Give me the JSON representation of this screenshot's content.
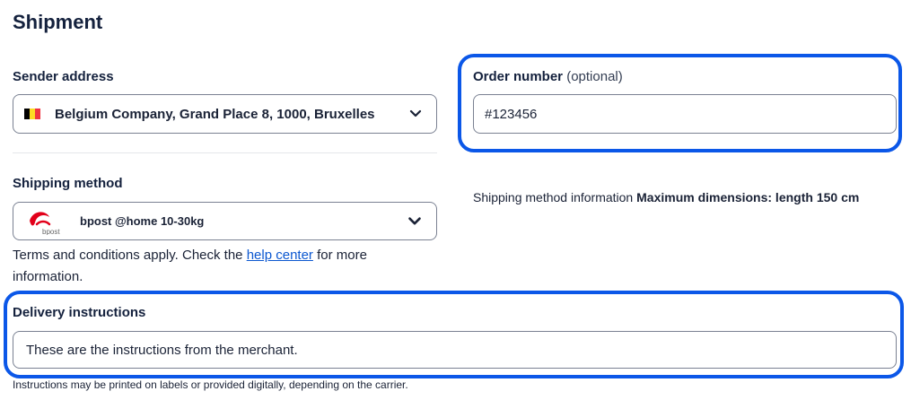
{
  "page": {
    "title": "Shipment"
  },
  "sender": {
    "label": "Sender address",
    "value": "Belgium Company, Grand Place 8, 1000, Bruxelles",
    "flag_colors": [
      "#000000",
      "#FDDA24",
      "#EF3340"
    ]
  },
  "order": {
    "label": "Order number",
    "label_suffix": "(optional)",
    "value": "#123456"
  },
  "shipping": {
    "label": "Shipping method",
    "value": "bpost @home 10-30kg",
    "carrier_logo_text": "bpost",
    "info_prefix": "Shipping method information",
    "info_bold": "Maximum dimensions: length 150 cm",
    "terms_before": "Terms and conditions apply. Check the",
    "terms_link": "help center",
    "terms_after": "for more",
    "terms_line2": "information."
  },
  "delivery": {
    "label": "Delivery instructions",
    "value": "These are the instructions from the merchant.",
    "note": "Instructions may be printed on labels or provided digitally, depending on the carrier."
  },
  "colors": {
    "highlight": "#0b57e8",
    "link": "#0b57d0",
    "bpost_red": "#e2001a"
  }
}
